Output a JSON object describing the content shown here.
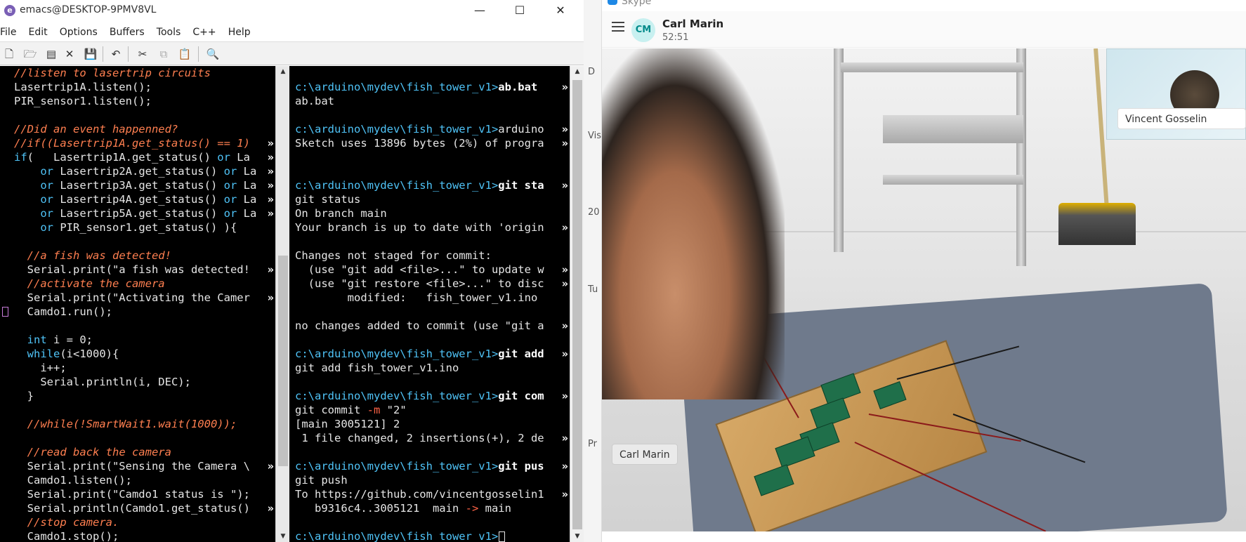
{
  "emacs": {
    "title": "emacs@DESKTOP-9PMV8VL",
    "menu": [
      "File",
      "Edit",
      "Options",
      "Buffers",
      "Tools",
      "C++",
      "Help"
    ],
    "window_controls": {
      "minimize": "—",
      "maximize": "☐",
      "close": "✕"
    },
    "code_lines": [
      [
        [
          "c",
          "//listen to lasertrip circuits"
        ]
      ],
      [
        [
          "n",
          "Lasertrip1A.listen();"
        ]
      ],
      [
        [
          "n",
          "PIR_sensor1.listen();"
        ]
      ],
      [
        [
          "n",
          ""
        ]
      ],
      [
        [
          "c",
          "//Did an event happenned?"
        ]
      ],
      [
        [
          "c",
          "//if((Lasertrip1A.get_status() == 1) "
        ]
      ],
      [
        [
          "k",
          "if"
        ],
        [
          "n",
          "(   Lasertrip1A.get_status() "
        ],
        [
          "k",
          "or"
        ],
        [
          "n",
          " La"
        ]
      ],
      [
        [
          "n",
          "    "
        ],
        [
          "k",
          "or"
        ],
        [
          "n",
          " Lasertrip2A.get_status() "
        ],
        [
          "k",
          "or"
        ],
        [
          "n",
          " La"
        ]
      ],
      [
        [
          "n",
          "    "
        ],
        [
          "k",
          "or"
        ],
        [
          "n",
          " Lasertrip3A.get_status() "
        ],
        [
          "k",
          "or"
        ],
        [
          "n",
          " La"
        ]
      ],
      [
        [
          "n",
          "    "
        ],
        [
          "k",
          "or"
        ],
        [
          "n",
          " Lasertrip4A.get_status() "
        ],
        [
          "k",
          "or"
        ],
        [
          "n",
          " La"
        ]
      ],
      [
        [
          "n",
          "    "
        ],
        [
          "k",
          "or"
        ],
        [
          "n",
          " Lasertrip5A.get_status() "
        ],
        [
          "k",
          "or"
        ],
        [
          "n",
          " La"
        ]
      ],
      [
        [
          "n",
          "    "
        ],
        [
          "k",
          "or"
        ],
        [
          "n",
          " PIR_sensor1.get_status() ){"
        ]
      ],
      [
        [
          "n",
          ""
        ]
      ],
      [
        [
          "n",
          "  "
        ],
        [
          "c",
          "//a fish was detected!"
        ]
      ],
      [
        [
          "n",
          "  Serial.print(\"a fish was detected!"
        ]
      ],
      [
        [
          "n",
          "  "
        ],
        [
          "c",
          "//activate the camera"
        ]
      ],
      [
        [
          "n",
          "  Serial.print(\"Activating the Camer"
        ]
      ],
      [
        [
          "n",
          "  Camdo1.run();"
        ]
      ],
      [
        [
          "n",
          ""
        ]
      ],
      [
        [
          "n",
          "  "
        ],
        [
          "k",
          "int"
        ],
        [
          "n",
          " i = 0;"
        ]
      ],
      [
        [
          "n",
          "  "
        ],
        [
          "k",
          "while"
        ],
        [
          "n",
          "(i<1000){"
        ]
      ],
      [
        [
          "n",
          "    i++;"
        ]
      ],
      [
        [
          "n",
          "    Serial.println(i, DEC);"
        ]
      ],
      [
        [
          "n",
          "  }"
        ]
      ],
      [
        [
          "n",
          ""
        ]
      ],
      [
        [
          "n",
          "  "
        ],
        [
          "c",
          "//while(!SmartWait1.wait(1000));"
        ]
      ],
      [
        [
          "n",
          ""
        ]
      ],
      [
        [
          "n",
          "  "
        ],
        [
          "c",
          "//read back the camera"
        ]
      ],
      [
        [
          "n",
          "  Serial.print(\"Sensing the Camera \\"
        ]
      ],
      [
        [
          "n",
          "  Camdo1.listen();"
        ]
      ],
      [
        [
          "n",
          "  Serial.print(\"Camdo1 status is \");"
        ]
      ],
      [
        [
          "n",
          "  Serial.println(Camdo1.get_status()"
        ]
      ],
      [
        [
          "n",
          "  "
        ],
        [
          "c",
          "//stop camera."
        ]
      ],
      [
        [
          "n",
          "  Camdo1.stop();"
        ]
      ]
    ],
    "code_truncated_rows": [
      5,
      6,
      7,
      8,
      9,
      10,
      14,
      16,
      28,
      31
    ],
    "term_lines": [
      [],
      [
        [
          "p",
          "c:\\arduino\\mydev\\fish_tower_v1>"
        ],
        [
          "b",
          "ab.bat"
        ]
      ],
      [
        [
          "n",
          "ab.bat"
        ]
      ],
      [],
      [
        [
          "p",
          "c:\\arduino\\mydev\\fish_tower_v1>"
        ],
        [
          "n",
          "arduino"
        ]
      ],
      [
        [
          "n",
          "Sketch uses 13896 bytes (2%) of progra"
        ]
      ],
      [],
      [],
      [
        [
          "p",
          "c:\\arduino\\mydev\\fish_tower_v1>"
        ],
        [
          "b",
          "git sta"
        ]
      ],
      [
        [
          "n",
          "git status"
        ]
      ],
      [
        [
          "n",
          "On branch main"
        ]
      ],
      [
        [
          "n",
          "Your branch is up to date with 'origin"
        ]
      ],
      [],
      [
        [
          "n",
          "Changes not staged for commit:"
        ]
      ],
      [
        [
          "n",
          "  (use \"git add <file>...\" to update w"
        ]
      ],
      [
        [
          "n",
          "  (use \"git restore <file>...\" to disc"
        ]
      ],
      [
        [
          "n",
          "        modified:   fish_tower_v1.ino"
        ]
      ],
      [],
      [
        [
          "n",
          "no changes added to commit (use \"git a"
        ]
      ],
      [],
      [
        [
          "p",
          "c:\\arduino\\mydev\\fish_tower_v1>"
        ],
        [
          "b",
          "git add"
        ]
      ],
      [
        [
          "n",
          "git add fish_tower_v1.ino"
        ]
      ],
      [],
      [
        [
          "p",
          "c:\\arduino\\mydev\\fish_tower_v1>"
        ],
        [
          "b",
          "git com"
        ]
      ],
      [
        [
          "n",
          "git commit "
        ],
        [
          "f",
          "-m"
        ],
        [
          "n",
          " \"2\""
        ]
      ],
      [
        [
          "n",
          "[main 3005121] 2"
        ]
      ],
      [
        [
          "n",
          " 1 file changed, 2 insertions(+), 2 de"
        ]
      ],
      [],
      [
        [
          "p",
          "c:\\arduino\\mydev\\fish_tower_v1>"
        ],
        [
          "b",
          "git pus"
        ]
      ],
      [
        [
          "n",
          "git push"
        ]
      ],
      [
        [
          "n",
          "To https://github.com/vincentgosselin1"
        ]
      ],
      [
        [
          "n",
          "   b9316c4..3005121  main "
        ],
        [
          "f",
          "->"
        ],
        [
          "n",
          " main"
        ]
      ],
      [],
      [
        [
          "p",
          "c:\\arduino\\mydev\\fish_tower_v1>"
        ]
      ]
    ],
    "term_truncated_rows": [
      1,
      4,
      5,
      8,
      11,
      14,
      15,
      18,
      20,
      23,
      26,
      28,
      30
    ],
    "truncation_glyph": "»"
  },
  "skype": {
    "app_title": "Skype",
    "contact_initials": "CM",
    "contact_name": "Carl Marin",
    "call_duration": "52:51",
    "remote_label": "Vincent Gosselin",
    "self_label": "Carl Marin",
    "edge_fragments": [
      "D",
      "Vis",
      "20",
      "Tu",
      "Pr"
    ]
  }
}
